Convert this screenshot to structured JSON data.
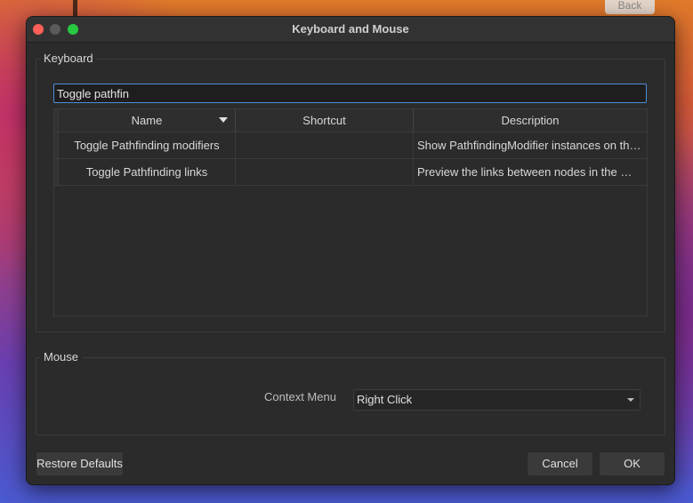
{
  "background": {
    "back_label": "Back"
  },
  "window": {
    "title": "Keyboard and Mouse"
  },
  "keyboard": {
    "group_label": "Keyboard",
    "search_value": "Toggle pathfin",
    "columns": [
      "Name",
      "Shortcut",
      "Description"
    ],
    "rows": [
      {
        "name": "Toggle Pathfinding modifiers",
        "shortcut": "",
        "description": "Show PathfindingModifier instances on the …"
      },
      {
        "name": "Toggle Pathfinding links",
        "shortcut": "",
        "description": "Preview the links between nodes in the …"
      }
    ]
  },
  "mouse": {
    "group_label": "Mouse",
    "context_menu_label": "Context Menu",
    "context_menu_value": "Right Click"
  },
  "buttons": {
    "restore": "Restore Defaults",
    "cancel": "Cancel",
    "ok": "OK"
  },
  "colors": {
    "accent": "#4a8fd8",
    "dialog_bg": "#2b2b2b"
  }
}
